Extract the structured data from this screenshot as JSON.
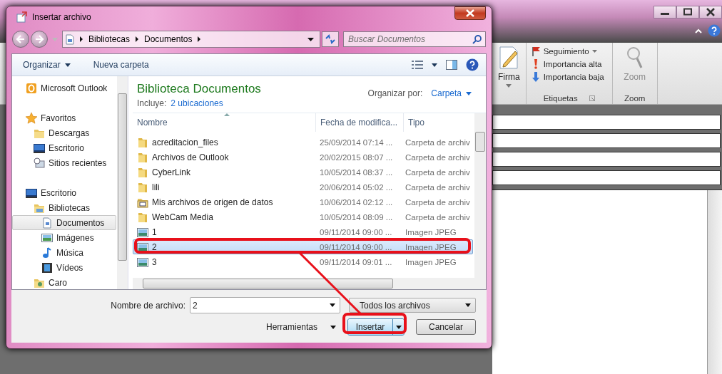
{
  "outlook_window": {
    "ribbon": {
      "signature_button": "Firma",
      "tags": [
        {
          "kind": "flag",
          "label": "Seguimiento",
          "dropdown": true
        },
        {
          "kind": "high",
          "label": "Importancia alta",
          "dropdown": false
        },
        {
          "kind": "low",
          "label": "Importancia baja",
          "dropdown": false
        }
      ],
      "tags_group": "Etiquetas",
      "zoom_button": "Zoom",
      "zoom_group": "Zoom"
    }
  },
  "dialog": {
    "title": "Insertar archivo",
    "breadcrumb": [
      "Bibliotecas",
      "Documentos"
    ],
    "search": {
      "placeholder": "Buscar Documentos"
    },
    "toolbar": {
      "organize": "Organizar",
      "new_folder": "Nueva carpeta"
    },
    "sidebar": {
      "items": [
        {
          "label": "Microsoft Outlook",
          "kind": "outlook",
          "selected": false
        },
        {
          "label": "Favoritos",
          "kind": "star",
          "selected": false,
          "children": [
            {
              "label": "Descargas",
              "kind": "folder",
              "selected": false
            },
            {
              "label": "Escritorio",
              "kind": "desktop",
              "selected": false
            },
            {
              "label": "Sitios recientes",
              "kind": "recent",
              "selected": false
            }
          ]
        },
        {
          "label": "Escritorio",
          "kind": "desktop",
          "selected": false,
          "children": [
            {
              "label": "Bibliotecas",
              "kind": "library",
              "selected": false,
              "children": [
                {
                  "label": "Documentos",
                  "kind": "document",
                  "selected": true
                },
                {
                  "label": "Imágenes",
                  "kind": "image",
                  "selected": false
                },
                {
                  "label": "Música",
                  "kind": "music",
                  "selected": false
                },
                {
                  "label": "Vídeos",
                  "kind": "video",
                  "selected": false
                }
              ]
            },
            {
              "label": "Caro",
              "kind": "user",
              "selected": false
            }
          ]
        }
      ]
    },
    "library": {
      "title": "Biblioteca Documentos",
      "includes_label": "Incluye:",
      "includes_link": "2 ubicaciones",
      "arrange_label": "Organizar por:",
      "arrange_value": "Carpeta"
    },
    "table": {
      "columns": [
        {
          "label": "Nombre",
          "sorted": true
        },
        {
          "label": "Fecha de modifica...",
          "sorted": false
        },
        {
          "label": "Tipo",
          "sorted": false
        }
      ],
      "rows": [
        {
          "name": "acreditacion_files",
          "date": "25/09/2014 07:14 ...",
          "type": "Carpeta de archiv",
          "kind": "folder",
          "selected": false
        },
        {
          "name": "Archivos de Outlook",
          "date": "20/02/2015 08:07 ...",
          "type": "Carpeta de archiv",
          "kind": "folder",
          "selected": false
        },
        {
          "name": "CyberLink",
          "date": "10/05/2014 08:37 ...",
          "type": "Carpeta de archiv",
          "kind": "folder",
          "selected": false
        },
        {
          "name": "lili",
          "date": "20/06/2014 05:02 ...",
          "type": "Carpeta de archiv",
          "kind": "folder",
          "selected": false
        },
        {
          "name": "Mis archivos de origen de datos",
          "date": "10/06/2014 02:12 ...",
          "type": "Carpeta de archiv",
          "kind": "data-folder",
          "selected": false
        },
        {
          "name": "WebCam Media",
          "date": "10/05/2014 08:09 ...",
          "type": "Carpeta de archiv",
          "kind": "folder",
          "selected": false
        },
        {
          "name": "1",
          "date": "09/11/2014 09:00 ...",
          "type": "Imagen JPEG",
          "kind": "image",
          "selected": false
        },
        {
          "name": "2",
          "date": "09/11/2014 09:00 ...",
          "type": "Imagen JPEG",
          "kind": "image",
          "selected": true
        },
        {
          "name": "3",
          "date": "09/11/2014 09:01 ...",
          "type": "Imagen JPEG",
          "kind": "image",
          "selected": false
        }
      ]
    },
    "filename": {
      "label": "Nombre de archivo:",
      "value": "2"
    },
    "filter": {
      "value": "Todos los archivos"
    },
    "buttons": {
      "tools": "Herramientas",
      "insert": "Insertar",
      "cancel": "Cancelar"
    }
  }
}
